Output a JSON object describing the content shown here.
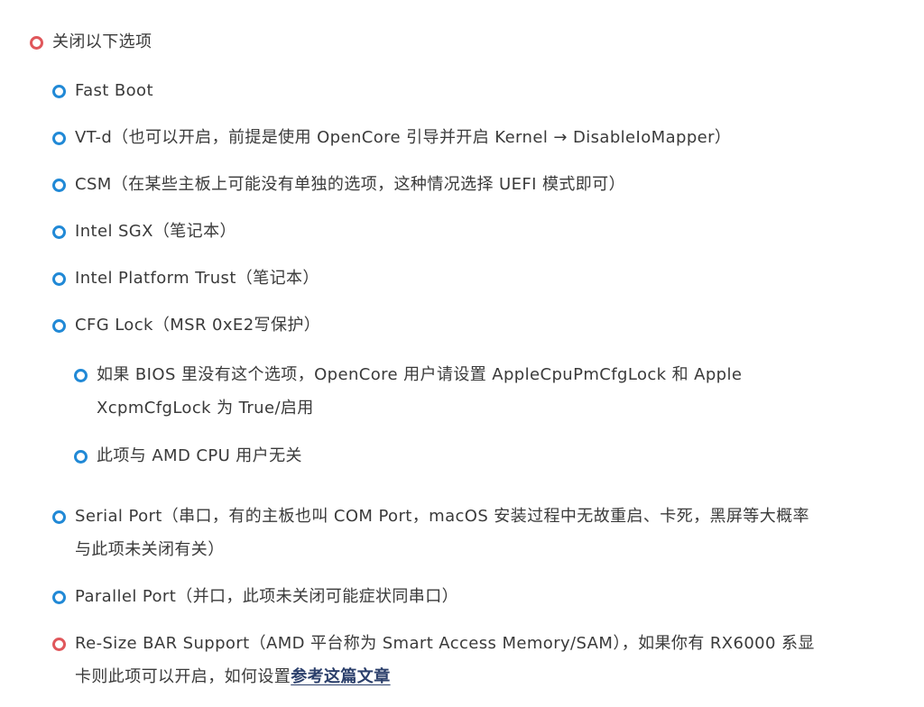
{
  "heading": {
    "label": "关闭以下选项"
  },
  "items": [
    {
      "label": "Fast Boot"
    },
    {
      "label": "VT-d（也可以开启，前提是使用 OpenCore 引导并开启 Kernel → DisableIoMapper）"
    },
    {
      "label": "CSM（在某些主板上可能没有单独的选项，这种情况选择 UEFI 模式即可）"
    },
    {
      "label": "Intel SGX（笔记本）"
    },
    {
      "label": "Intel Platform Trust（笔记本）"
    },
    {
      "label": "CFG Lock（MSR 0xE2写保护）"
    }
  ],
  "subitems": [
    {
      "line1": "如果 BIOS 里没有这个选项，OpenCore 用户请设置 AppleCpuPmCfgLock 和 Apple",
      "line2": "XcpmCfgLock 为 True/启用"
    },
    {
      "line1": "此项与 AMD CPU 用户无关"
    }
  ],
  "serial_port": {
    "line1": "Serial Port（串口，有的主板也叫 COM Port，macOS 安装过程中无故重启、卡死，黑屏等大概率",
    "line2": "与此项未关闭有关）"
  },
  "parallel_port": {
    "label": "Parallel Port（并口，此项未关闭可能症状同串口）"
  },
  "resize_bar": {
    "line1": "Re-Size BAR Support（AMD 平台称为 Smart Access Memory/SAM），如果你有 RX6000 系显",
    "line2_prefix": "卡则此项可以开启，如何设置",
    "link_text": "参考这篇文章"
  },
  "colors": {
    "bullet_red": "#e0575b",
    "bullet_blue": "#2189d6",
    "text": "#3a3a3a",
    "link": "#2b3f6b"
  },
  "icons": {
    "bullet": "hollow-circle-bullet"
  }
}
